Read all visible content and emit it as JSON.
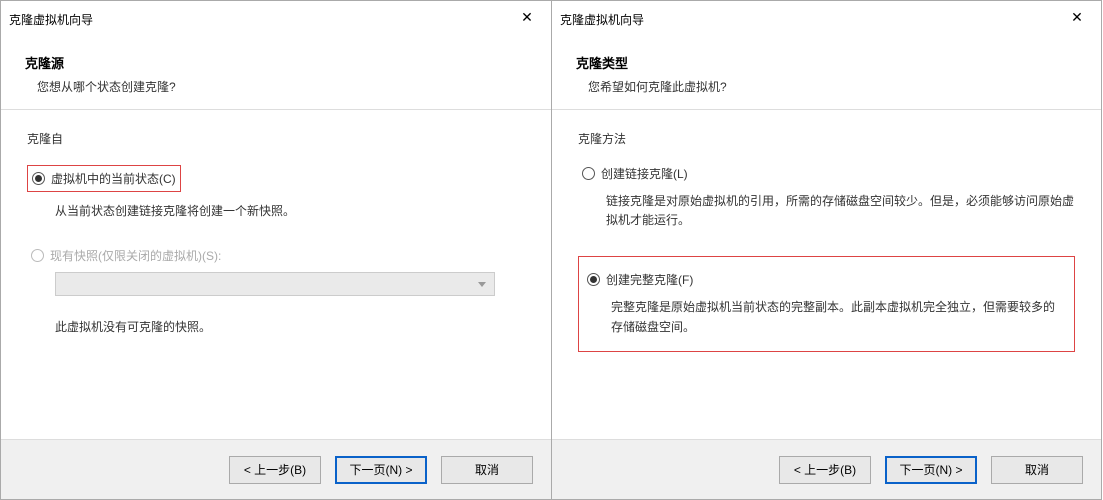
{
  "dialogs": {
    "left": {
      "title": "克隆虚拟机向导",
      "headerTitle": "克隆源",
      "headerSub": "您想从哪个状态创建克隆?",
      "groupLabel": "克隆自",
      "opt1": {
        "label": "虚拟机中的当前状态(C)",
        "desc": "从当前状态创建链接克隆将创建一个新快照。"
      },
      "opt2": {
        "label": "现有快照(仅限关闭的虚拟机)(S):",
        "note": "此虚拟机没有可克隆的快照。"
      },
      "buttons": {
        "back": "< 上一步(B)",
        "next": "下一页(N) >",
        "cancel": "取消"
      }
    },
    "right": {
      "title": "克隆虚拟机向导",
      "headerTitle": "克隆类型",
      "headerSub": "您希望如何克隆此虚拟机?",
      "groupLabel": "克隆方法",
      "opt1": {
        "label": "创建链接克隆(L)",
        "desc": "链接克隆是对原始虚拟机的引用，所需的存储磁盘空间较少。但是，必须能够访问原始虚拟机才能运行。"
      },
      "opt2": {
        "label": "创建完整克隆(F)",
        "desc": "完整克隆是原始虚拟机当前状态的完整副本。此副本虚拟机完全独立，但需要较多的存储磁盘空间。"
      },
      "buttons": {
        "back": "< 上一步(B)",
        "next": "下一页(N) >",
        "cancel": "取消"
      }
    }
  }
}
